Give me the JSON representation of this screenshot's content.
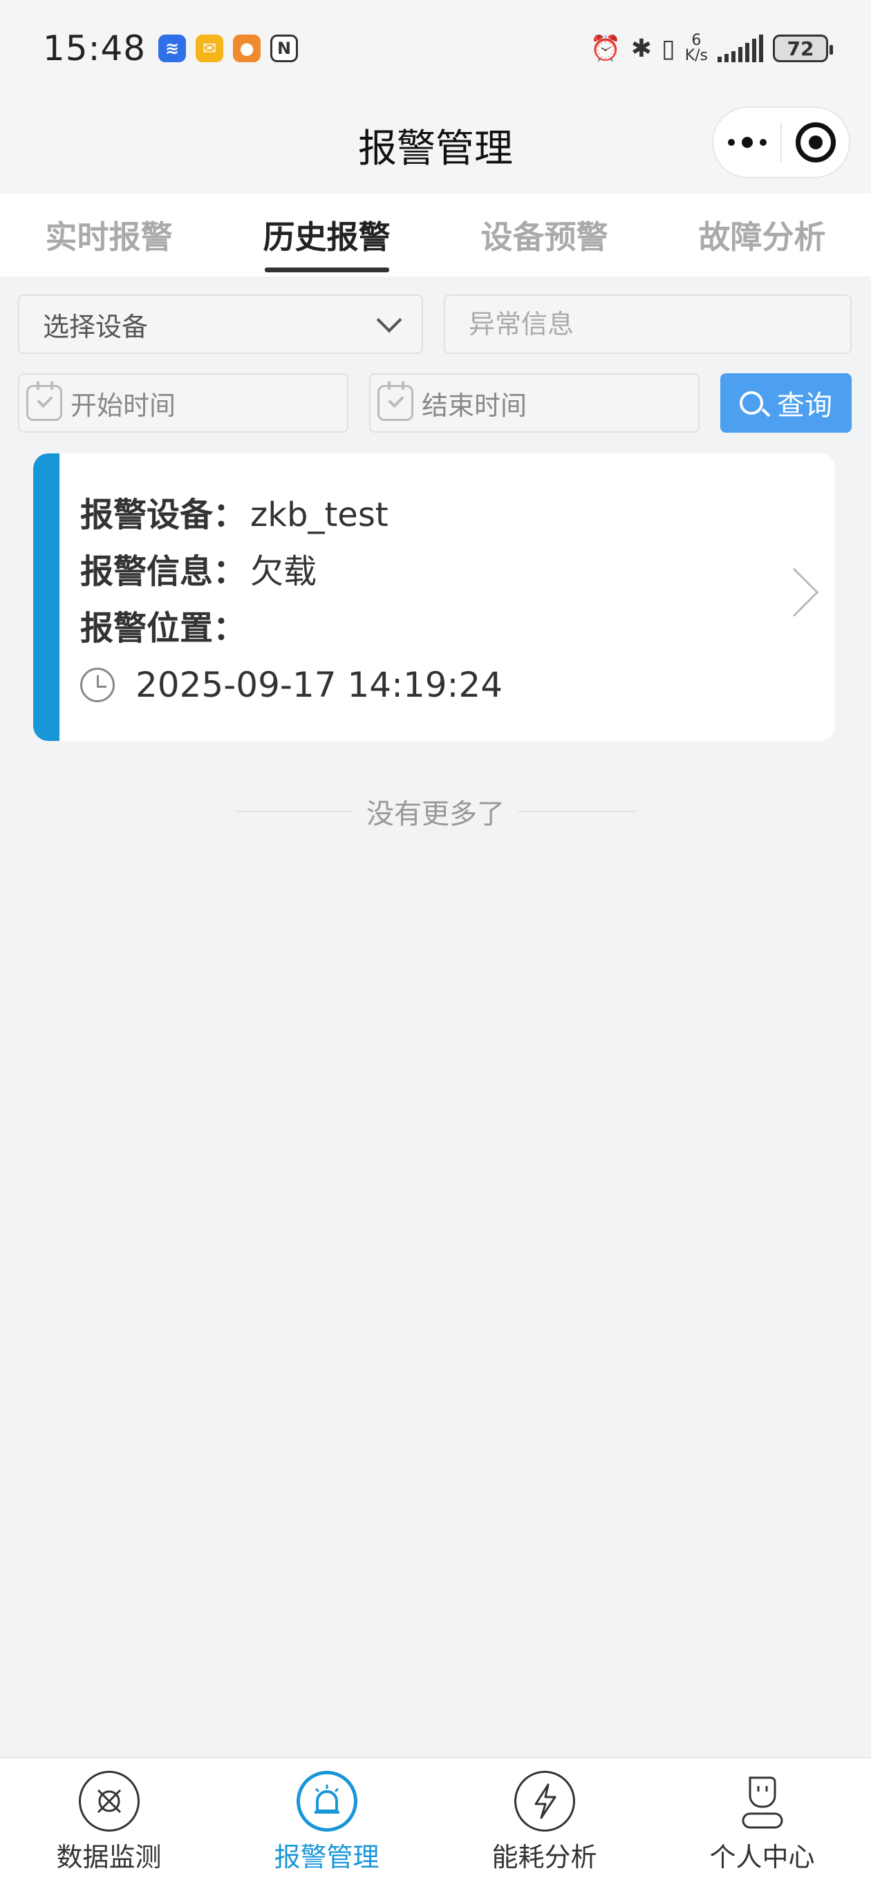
{
  "status_bar": {
    "time": "15:48",
    "net_speed_top": "6",
    "net_speed_bottom": "K/s",
    "battery": "72"
  },
  "header": {
    "title": "报警管理"
  },
  "tabs": [
    {
      "label": "实时报警",
      "active": false
    },
    {
      "label": "历史报警",
      "active": true
    },
    {
      "label": "设备预警",
      "active": false
    },
    {
      "label": "故障分析",
      "active": false
    }
  ],
  "filters": {
    "device_select": "选择设备",
    "abnormal_placeholder": "异常信息",
    "start_time": "开始时间",
    "end_time": "结束时间",
    "query_label": "查询"
  },
  "alarm_card": {
    "device_label": "报警设备：",
    "device_value": "zkb_test",
    "info_label": "报警信息：",
    "info_value": "欠载",
    "location_label": "报警位置：",
    "location_value": "",
    "timestamp": "2025-09-17 14:19:24",
    "accent_color": "#1996d8"
  },
  "list_footer": "没有更多了",
  "tabbar": [
    {
      "label": "数据监测",
      "icon": "monitor-icon"
    },
    {
      "label": "报警管理",
      "icon": "alarm-icon",
      "active": true
    },
    {
      "label": "能耗分析",
      "icon": "energy-icon"
    },
    {
      "label": "个人中心",
      "icon": "user-icon"
    }
  ]
}
